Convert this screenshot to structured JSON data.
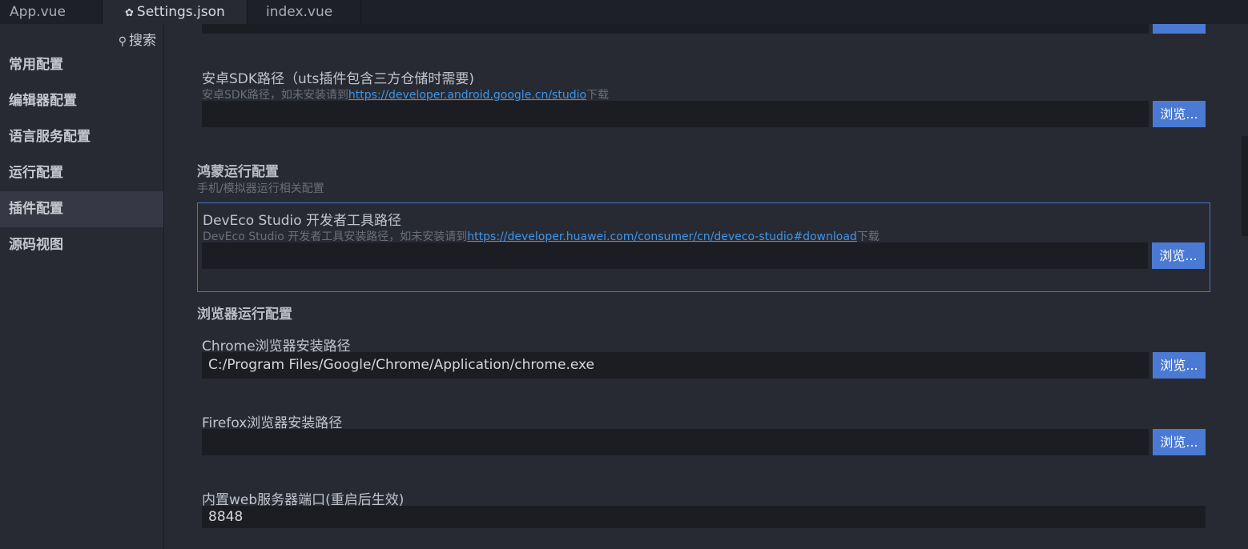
{
  "tabs": [
    {
      "label": "App.vue"
    },
    {
      "label": "Settings.json",
      "icon": "gear-icon"
    },
    {
      "label": "index.vue"
    }
  ],
  "sidebar": {
    "search_label": "搜索",
    "items": [
      {
        "label": "常用配置"
      },
      {
        "label": "编辑器配置"
      },
      {
        "label": "语言服务配置"
      },
      {
        "label": "运行配置"
      },
      {
        "label": "插件配置",
        "active": true
      },
      {
        "label": "源码视图"
      }
    ]
  },
  "main": {
    "browse_label": "浏览...",
    "android_sdk": {
      "label": "安卓SDK路径（uts插件包含三方仓储时需要)",
      "desc_prefix": "安卓SDK路径，如未安装请到",
      "desc_link": "https://developer.android.google.cn/studio",
      "desc_suffix": "下载",
      "value": ""
    },
    "harmony": {
      "title": "鸿蒙运行配置",
      "subtitle": "手机/模拟器运行相关配置",
      "deveco": {
        "label": "DevEco Studio 开发者工具路径",
        "desc_prefix": "DevEco Studio 开发者工具安装路径，如未安装请到",
        "desc_link": "https://developer.huawei.com/consumer/cn/deveco-studio#download",
        "desc_suffix": "下载",
        "value": ""
      }
    },
    "browser": {
      "title": "浏览器运行配置",
      "chrome": {
        "label": "Chrome浏览器安装路径",
        "value": "C:/Program Files/Google/Chrome/Application/chrome.exe"
      },
      "firefox": {
        "label": "Firefox浏览器安装路径",
        "value": ""
      },
      "web_port": {
        "label": "内置web服务器端口(重启后生效)",
        "value": "8848"
      }
    }
  },
  "colors": {
    "accent": "#4a7ad3",
    "link": "#3f95e8",
    "background": "#272a33",
    "input_bg": "#1c1d22"
  }
}
